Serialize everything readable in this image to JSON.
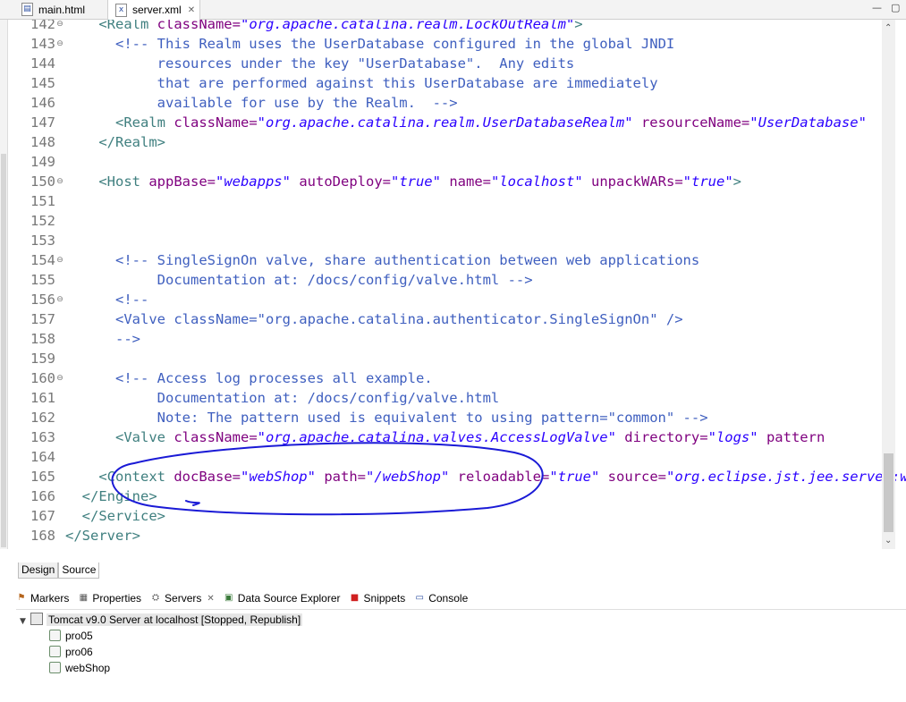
{
  "tabs": [
    {
      "label": "main.html",
      "icon": "html-file-icon"
    },
    {
      "label": "server.xml",
      "icon": "xml-file-icon",
      "active": true
    }
  ],
  "window_buttons": [
    "minimize-icon",
    "maximize-icon"
  ],
  "editor": {
    "lines": [
      {
        "num": "142",
        "fold": true,
        "parts": [
          [
            "plain",
            "    "
          ],
          [
            "tag",
            "<Realm "
          ],
          [
            "attr",
            "className="
          ],
          [
            "val",
            "\"org.apache.catalina.realm.LockOutRealm\""
          ],
          [
            "tag",
            ">"
          ]
        ]
      },
      {
        "num": "143",
        "fold": true,
        "parts": [
          [
            "plain",
            "      "
          ],
          [
            "cmt",
            "<!-- This Realm uses the UserDatabase configured in the global JNDI"
          ]
        ]
      },
      {
        "num": "144",
        "parts": [
          [
            "cmt",
            "           resources under the key \"UserDatabase\".  Any edits"
          ]
        ]
      },
      {
        "num": "145",
        "parts": [
          [
            "cmt",
            "           that are performed against this UserDatabase are immediately"
          ]
        ]
      },
      {
        "num": "146",
        "parts": [
          [
            "cmt",
            "           available for use by the Realm.  -->"
          ]
        ]
      },
      {
        "num": "147",
        "parts": [
          [
            "plain",
            "      "
          ],
          [
            "tag",
            "<Realm "
          ],
          [
            "attr",
            "className="
          ],
          [
            "val",
            "\"org.apache.catalina.realm.UserDatabaseRealm\""
          ],
          [
            "plain",
            " "
          ],
          [
            "attr",
            "resourceName="
          ],
          [
            "val",
            "\"UserDatabase\""
          ]
        ]
      },
      {
        "num": "148",
        "parts": [
          [
            "plain",
            "    "
          ],
          [
            "tag",
            "</Realm>"
          ]
        ]
      },
      {
        "num": "149",
        "parts": []
      },
      {
        "num": "150",
        "fold": true,
        "parts": [
          [
            "plain",
            "    "
          ],
          [
            "tag",
            "<Host "
          ],
          [
            "attr",
            "appBase="
          ],
          [
            "val",
            "\"webapps\""
          ],
          [
            "plain",
            " "
          ],
          [
            "attr",
            "autoDeploy="
          ],
          [
            "val",
            "\"true\""
          ],
          [
            "plain",
            " "
          ],
          [
            "attr",
            "name="
          ],
          [
            "val",
            "\"localhost\""
          ],
          [
            "plain",
            " "
          ],
          [
            "attr",
            "unpackWARs="
          ],
          [
            "val",
            "\"true\""
          ],
          [
            "tag",
            ">"
          ]
        ]
      },
      {
        "num": "151",
        "parts": []
      },
      {
        "num": "152",
        "parts": []
      },
      {
        "num": "153",
        "parts": []
      },
      {
        "num": "154",
        "fold": true,
        "parts": [
          [
            "plain",
            "      "
          ],
          [
            "cmt",
            "<!-- SingleSignOn valve, share authentication between web applications"
          ]
        ]
      },
      {
        "num": "155",
        "parts": [
          [
            "cmt",
            "           Documentation at: /docs/config/valve.html -->"
          ]
        ]
      },
      {
        "num": "156",
        "fold": true,
        "parts": [
          [
            "plain",
            "      "
          ],
          [
            "cmt",
            "<!--"
          ]
        ]
      },
      {
        "num": "157",
        "parts": [
          [
            "cmt",
            "      <Valve className=\"org.apache.catalina.authenticator.SingleSignOn\" />"
          ]
        ]
      },
      {
        "num": "158",
        "parts": [
          [
            "cmt",
            "      -->"
          ]
        ]
      },
      {
        "num": "159",
        "parts": []
      },
      {
        "num": "160",
        "fold": true,
        "parts": [
          [
            "plain",
            "      "
          ],
          [
            "cmt",
            "<!-- Access log processes all example."
          ]
        ]
      },
      {
        "num": "161",
        "parts": [
          [
            "cmt",
            "           Documentation at: /docs/config/valve.html"
          ]
        ]
      },
      {
        "num": "162",
        "parts": [
          [
            "cmt",
            "           Note: The pattern used is equivalent to using pattern=\"common\" -->"
          ]
        ]
      },
      {
        "num": "163",
        "parts": [
          [
            "plain",
            "      "
          ],
          [
            "tag",
            "<Valve "
          ],
          [
            "attr",
            "className="
          ],
          [
            "val",
            "\"org.apache.catalina.valves.AccessLogValve\""
          ],
          [
            "plain",
            " "
          ],
          [
            "attr",
            "directory="
          ],
          [
            "val",
            "\"logs\""
          ],
          [
            "plain",
            " "
          ],
          [
            "attr",
            "pattern"
          ]
        ]
      },
      {
        "num": "164",
        "parts": []
      },
      {
        "num": "165",
        "parts": [
          [
            "plain",
            "    "
          ],
          [
            "tag",
            "<Context "
          ],
          [
            "attr",
            "docBase="
          ],
          [
            "val",
            "\"webShop\""
          ],
          [
            "plain",
            " "
          ],
          [
            "attr",
            "path="
          ],
          [
            "val",
            "\"/webShop\""
          ],
          [
            "plain",
            " "
          ],
          [
            "attr",
            "reloadable="
          ],
          [
            "val",
            "\"true\""
          ],
          [
            "plain",
            " "
          ],
          [
            "attr",
            "source="
          ],
          [
            "val",
            "\"org.eclipse.jst.jee.server:webShop\""
          ]
        ]
      },
      {
        "num": "166",
        "parts": [
          [
            "plain",
            "  "
          ],
          [
            "tag",
            "</Engine>"
          ]
        ]
      },
      {
        "num": "167",
        "parts": [
          [
            "plain",
            "  "
          ],
          [
            "tag",
            "</Service>"
          ]
        ]
      },
      {
        "num": "168",
        "parts": [
          [
            "tag",
            "</Server>"
          ]
        ]
      }
    ]
  },
  "editor_mode_tabs": [
    "Design",
    "Source"
  ],
  "views": [
    {
      "label": "Markers",
      "icon": "markers-icon"
    },
    {
      "label": "Properties",
      "icon": "properties-icon"
    },
    {
      "label": "Servers",
      "icon": "servers-icon",
      "active": true
    },
    {
      "label": "Data Source Explorer",
      "icon": "data-source-icon"
    },
    {
      "label": "Snippets",
      "icon": "snippets-icon"
    },
    {
      "label": "Console",
      "icon": "console-icon"
    }
  ],
  "servers": {
    "server_label": "Tomcat v9.0 Server at localhost  [Stopped, Republish]",
    "projects": [
      "pro05",
      "pro06",
      "webShop"
    ]
  },
  "annotation_color": "#1a1ad6"
}
